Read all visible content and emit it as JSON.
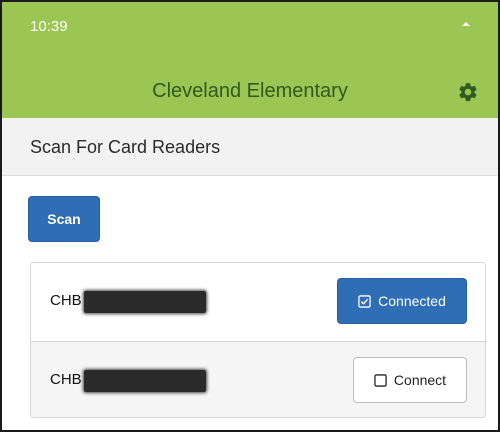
{
  "status_bar": {
    "time": "10:39",
    "icons": [
      "signal-icon"
    ]
  },
  "header": {
    "title": "Cleveland Elementary",
    "settings_icon": "gear-icon"
  },
  "section": {
    "title": "Scan For Card Readers"
  },
  "scan": {
    "label": "Scan"
  },
  "devices": [
    {
      "name": "CHB",
      "button_label": "Connected",
      "button_icon": "checkbox-checked-icon",
      "state": "connected"
    },
    {
      "name": "CHB",
      "button_label": "Connect",
      "button_icon": "checkbox-empty-icon",
      "state": "disconnected"
    }
  ],
  "colors": {
    "header_bg": "#9bc653",
    "title_text": "#2f5a20",
    "primary": "#2f6eb5",
    "section_bg": "#f2f2f2"
  }
}
